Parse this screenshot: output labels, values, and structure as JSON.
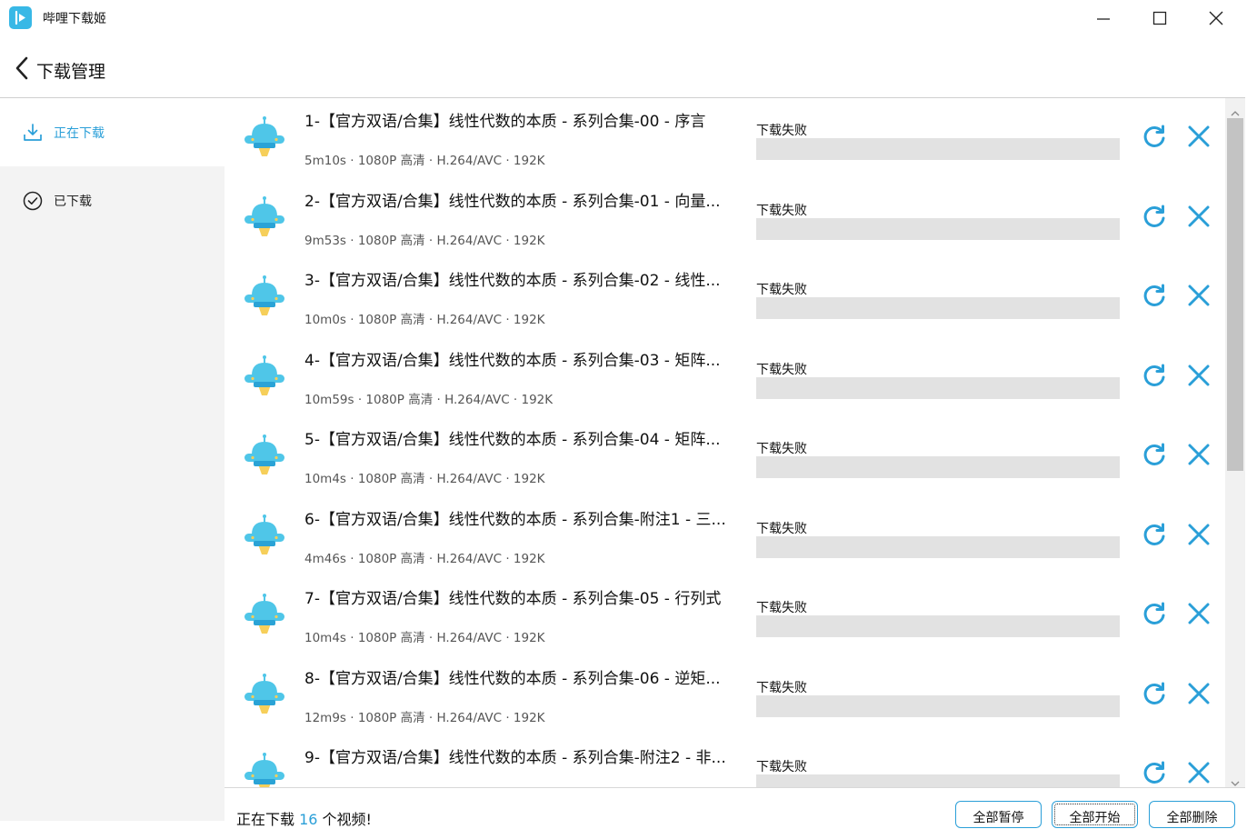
{
  "app": {
    "title": "哔哩下载姬"
  },
  "header": {
    "title": "下载管理"
  },
  "sidebar": {
    "items": [
      {
        "label": "正在下载",
        "icon": "download-icon",
        "active": true
      },
      {
        "label": "已下载",
        "icon": "check-circle-icon",
        "active": false
      }
    ]
  },
  "colors": {
    "accent": "#2a9fd8",
    "progress_track": "#e2e2e2",
    "sidebar_bg": "#f3f3f3"
  },
  "downloads": [
    {
      "title": "1-【官方双语/合集】线性代数的本质 - 系列合集-00 - 序言",
      "meta": "5m10s · 1080P 高清 · H.264/AVC · 192K",
      "status": "下载失败",
      "progress": 0
    },
    {
      "title": "2-【官方双语/合集】线性代数的本质 - 系列合集-01 - 向量...",
      "meta": "9m53s · 1080P 高清 · H.264/AVC · 192K",
      "status": "下载失败",
      "progress": 0
    },
    {
      "title": "3-【官方双语/合集】线性代数的本质 - 系列合集-02 - 线性...",
      "meta": "10m0s · 1080P 高清 · H.264/AVC · 192K",
      "status": "下载失败",
      "progress": 0
    },
    {
      "title": "4-【官方双语/合集】线性代数的本质 - 系列合集-03 - 矩阵...",
      "meta": "10m59s · 1080P 高清 · H.264/AVC · 192K",
      "status": "下载失败",
      "progress": 0
    },
    {
      "title": "5-【官方双语/合集】线性代数的本质 - 系列合集-04 - 矩阵...",
      "meta": "10m4s · 1080P 高清 · H.264/AVC · 192K",
      "status": "下载失败",
      "progress": 0
    },
    {
      "title": "6-【官方双语/合集】线性代数的本质 - 系列合集-附注1 - 三...",
      "meta": "4m46s · 1080P 高清 · H.264/AVC · 192K",
      "status": "下载失败",
      "progress": 0
    },
    {
      "title": "7-【官方双语/合集】线性代数的本质 - 系列合集-05 - 行列式",
      "meta": "10m4s · 1080P 高清 · H.264/AVC · 192K",
      "status": "下载失败",
      "progress": 0
    },
    {
      "title": "8-【官方双语/合集】线性代数的本质 - 系列合集-06 - 逆矩...",
      "meta": "12m9s · 1080P 高清 · H.264/AVC · 192K",
      "status": "下载失败",
      "progress": 0
    },
    {
      "title": "9-【官方双语/合集】线性代数的本质 - 系列合集-附注2 - 非...",
      "meta": "",
      "status": "下载失败",
      "progress": 0
    }
  ],
  "footer": {
    "text_prefix": "正在下载 ",
    "count": "16",
    "text_suffix": " 个视频!",
    "pause_all": "全部暂停",
    "start_all": "全部开始",
    "delete_all": "全部删除"
  }
}
